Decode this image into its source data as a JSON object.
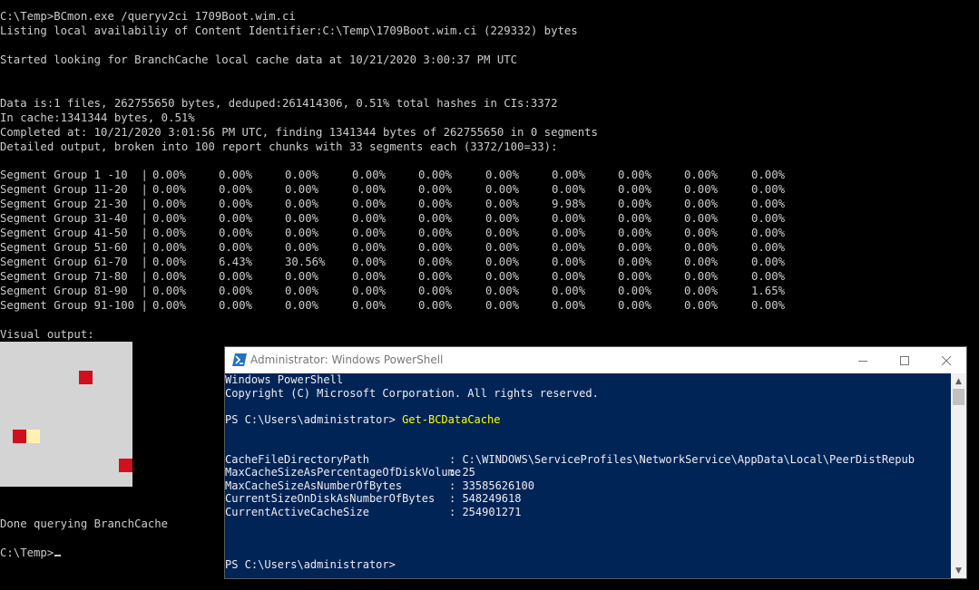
{
  "console": {
    "lines": [
      "C:\\Temp>BCmon.exe /queryv2ci 1709Boot.wim.ci",
      "Listing local availabiliy of Content Identifier:C:\\Temp\\1709Boot.wim.ci (229332) bytes",
      "",
      "Started looking for BranchCache local cache data at 10/21/2020 3:00:37 PM UTC",
      "",
      "",
      "Data is:1 files, 262755650 bytes, deduped:261414306, 0.51% total hashes in CIs:3372",
      "In cache:1341344 bytes, 0.51%",
      "Completed at: 10/21/2020 3:01:56 PM UTC, finding 1341344 bytes of 262755650 in 0 segments",
      "Detailed output, broken into 100 report chunks with 33 segments each (3372/100=33):"
    ],
    "segment_groups": [
      {
        "name": "Segment Group 1 -10  |",
        "values": [
          "0.00%",
          "0.00%",
          "0.00%",
          "0.00%",
          "0.00%",
          "0.00%",
          "0.00%",
          "0.00%",
          "0.00%",
          "0.00%"
        ]
      },
      {
        "name": "Segment Group 11-20  |",
        "values": [
          "0.00%",
          "0.00%",
          "0.00%",
          "0.00%",
          "0.00%",
          "0.00%",
          "0.00%",
          "0.00%",
          "0.00%",
          "0.00%"
        ]
      },
      {
        "name": "Segment Group 21-30  |",
        "values": [
          "0.00%",
          "0.00%",
          "0.00%",
          "0.00%",
          "0.00%",
          "0.00%",
          "9.98%",
          "0.00%",
          "0.00%",
          "0.00%"
        ]
      },
      {
        "name": "Segment Group 31-40  |",
        "values": [
          "0.00%",
          "0.00%",
          "0.00%",
          "0.00%",
          "0.00%",
          "0.00%",
          "0.00%",
          "0.00%",
          "0.00%",
          "0.00%"
        ]
      },
      {
        "name": "Segment Group 41-50  |",
        "values": [
          "0.00%",
          "0.00%",
          "0.00%",
          "0.00%",
          "0.00%",
          "0.00%",
          "0.00%",
          "0.00%",
          "0.00%",
          "0.00%"
        ]
      },
      {
        "name": "Segment Group 51-60  |",
        "values": [
          "0.00%",
          "0.00%",
          "0.00%",
          "0.00%",
          "0.00%",
          "0.00%",
          "0.00%",
          "0.00%",
          "0.00%",
          "0.00%"
        ]
      },
      {
        "name": "Segment Group 61-70  |",
        "values": [
          "0.00%",
          "6.43%",
          "30.56%",
          "0.00%",
          "0.00%",
          "0.00%",
          "0.00%",
          "0.00%",
          "0.00%",
          "0.00%"
        ]
      },
      {
        "name": "Segment Group 71-80  |",
        "values": [
          "0.00%",
          "0.00%",
          "0.00%",
          "0.00%",
          "0.00%",
          "0.00%",
          "0.00%",
          "0.00%",
          "0.00%",
          "0.00%"
        ]
      },
      {
        "name": "Segment Group 81-90  |",
        "values": [
          "0.00%",
          "0.00%",
          "0.00%",
          "0.00%",
          "0.00%",
          "0.00%",
          "0.00%",
          "0.00%",
          "0.00%",
          "1.65%"
        ]
      },
      {
        "name": "Segment Group 91-100 |",
        "values": [
          "0.00%",
          "0.00%",
          "0.00%",
          "0.00%",
          "0.00%",
          "0.00%",
          "0.00%",
          "0.00%",
          "0.00%",
          "0.00%"
        ]
      }
    ],
    "visual_label": "Visual output:",
    "visual_colors": {
      "background": "#d4d4d4",
      "hit": "#d0101e",
      "partial": "#fff2b0"
    },
    "done_text": "Done querying BranchCache",
    "prompt": "C:\\Temp>"
  },
  "powershell": {
    "title": "Administrator: Windows PowerShell",
    "header_lines": [
      "Windows PowerShell",
      "Copyright (C) Microsoft Corporation. All rights reserved."
    ],
    "prompt": "PS C:\\Users\\administrator> ",
    "command": "Get-BCDataCache",
    "properties": [
      {
        "key": "CacheFileDirectoryPath",
        "value": ": C:\\WINDOWS\\ServiceProfiles\\NetworkService\\AppData\\Local\\PeerDistRepub"
      },
      {
        "key": "MaxCacheSizeAsPercentageOfDiskVolume",
        "value": ": 25"
      },
      {
        "key": "MaxCacheSizeAsNumberOfBytes",
        "value": ": 33585626100"
      },
      {
        "key": "CurrentSizeOnDiskAsNumberOfBytes",
        "value": ": 548249618"
      },
      {
        "key": "CurrentActiveCacheSize",
        "value": ": 254901271"
      }
    ],
    "final_prompt": "PS C:\\Users\\administrator>",
    "colors": {
      "background": "#012456",
      "command": "#ffff00",
      "text": "#eeedf0"
    }
  }
}
